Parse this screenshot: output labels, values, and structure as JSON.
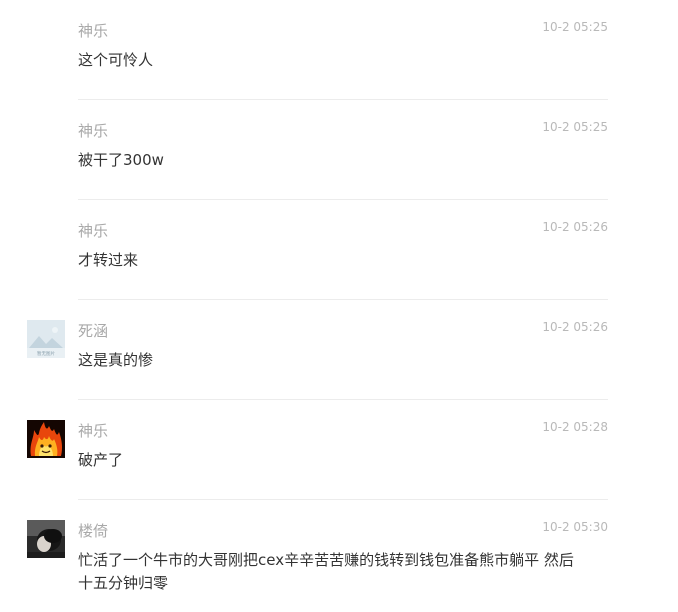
{
  "comments": [
    {
      "user": "神乐",
      "time": "10-2 05:25",
      "text": "这个可怜人",
      "avatar": "none"
    },
    {
      "user": "神乐",
      "time": "10-2 05:25",
      "text": "被干了300w",
      "avatar": "none"
    },
    {
      "user": "神乐",
      "time": "10-2 05:26",
      "text": "才转过来",
      "avatar": "none"
    },
    {
      "user": "死涵",
      "time": "10-2 05:26",
      "text": "这是真的惨",
      "avatar": "default-image-placeholder",
      "avatar_caption": "暂无图片"
    },
    {
      "user": "神乐",
      "time": "10-2 05:28",
      "text": "破产了",
      "avatar": "fire-face"
    },
    {
      "user": "楼倚",
      "time": "10-2 05:30",
      "text": "忙活了一个牛市的大哥刚把cex辛辛苦苦赚的钱转到钱包准备熊市躺平 然后十五分钟归零",
      "avatar": "person-photo"
    }
  ],
  "colors": {
    "username": "#a9a9a9",
    "time": "#b9b9b9",
    "text": "#333333",
    "divider": "#ececec"
  }
}
